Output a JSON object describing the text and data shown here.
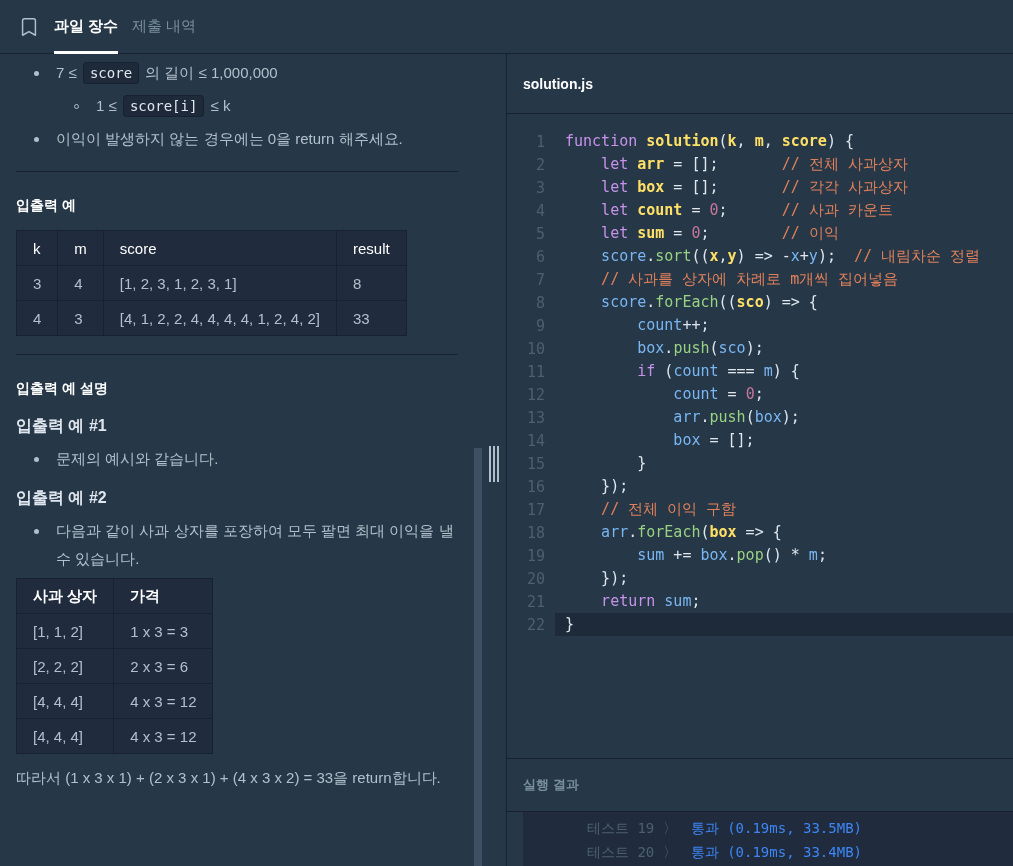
{
  "header": {
    "tabs": [
      {
        "label": "과일 장수",
        "selected": true
      },
      {
        "label": "제출 내역",
        "selected": false
      }
    ]
  },
  "problem": {
    "blocks": [
      {
        "kind": "bullets",
        "items": [
          {
            "parts": [
              {
                "kind": "text",
                "text": "7 ≤ "
              },
              {
                "kind": "code",
                "text": "score"
              },
              {
                "kind": "text",
                "text": " 의 길이 ≤ 1,000,000"
              }
            ],
            "children": [
              {
                "parts": [
                  {
                    "kind": "text",
                    "text": "1 ≤ "
                  },
                  {
                    "kind": "code",
                    "text": "score[i]"
                  },
                  {
                    "kind": "text",
                    "text": " ≤ k"
                  }
                ]
              }
            ]
          },
          {
            "parts": [
              {
                "kind": "text",
                "text": "이익이 발생하지 않는 경우에는 0을 return 해주세요."
              }
            ]
          }
        ]
      },
      {
        "kind": "divider"
      },
      {
        "kind": "heading",
        "text": "입출력 예"
      },
      {
        "kind": "table",
        "columns": [
          "k",
          "m",
          "score",
          "result"
        ],
        "rows": [
          [
            "3",
            "4",
            "[1, 2, 3, 1, 2, 3, 1]",
            "8"
          ],
          [
            "4",
            "3",
            "[4, 1, 2, 2, 4, 4, 4, 4, 1, 2, 4, 2]",
            "33"
          ]
        ]
      },
      {
        "kind": "divider"
      },
      {
        "kind": "heading",
        "text": "입출력 예 설명"
      },
      {
        "kind": "subheading",
        "text": "입출력 예 #1"
      },
      {
        "kind": "bullets",
        "items": [
          {
            "parts": [
              {
                "kind": "text",
                "text": "문제의 예시와 같습니다."
              }
            ]
          }
        ]
      },
      {
        "kind": "subheading",
        "text": "입출력 예 #2"
      },
      {
        "kind": "bullets",
        "items": [
          {
            "parts": [
              {
                "kind": "text",
                "text": "다음과 같이 사과 상자를 포장하여 모두 팔면 최대 이익을 낼 수 있습니다."
              }
            ]
          }
        ]
      },
      {
        "kind": "table",
        "columns": [
          "사과 상자",
          "가격"
        ],
        "rows": [
          [
            "[1, 1, 2]",
            "1 x 3 = 3"
          ],
          [
            "[2, 2, 2]",
            "2 x 3 = 6"
          ],
          [
            "[4, 4, 4]",
            "4 x 3 = 12"
          ],
          [
            "[4, 4, 4]",
            "4 x 3 = 12"
          ]
        ]
      },
      {
        "kind": "paragraph",
        "text": "따라서 (1 x 3 x 1) + (2 x 3 x 1) + (4 x 3 x 2) = 33을 return합니다."
      }
    ]
  },
  "editor": {
    "filename": "solution.js",
    "lines": [
      {
        "number": "1",
        "active": false,
        "tokens": [
          {
            "kind": "kw",
            "text": "function"
          },
          {
            "kind": "def",
            "text": " solution"
          },
          {
            "kind": "plain",
            "text": "("
          },
          {
            "kind": "def",
            "text": "k"
          },
          {
            "kind": "plain",
            "text": ", "
          },
          {
            "kind": "def",
            "text": "m"
          },
          {
            "kind": "plain",
            "text": ", "
          },
          {
            "kind": "def",
            "text": "score"
          },
          {
            "kind": "plain",
            "text": ") {"
          }
        ]
      },
      {
        "number": "2",
        "active": false,
        "tokens": [
          {
            "kind": "kw",
            "text": "    let"
          },
          {
            "kind": "def",
            "text": " arr"
          },
          {
            "kind": "plain",
            "text": " = [];       "
          },
          {
            "kind": "comment",
            "text": "// 전체 사과상자"
          }
        ]
      },
      {
        "number": "3",
        "active": false,
        "tokens": [
          {
            "kind": "kw",
            "text": "    let"
          },
          {
            "kind": "def",
            "text": " box"
          },
          {
            "kind": "plain",
            "text": " = [];       "
          },
          {
            "kind": "comment",
            "text": "// 각각 사과상자"
          }
        ]
      },
      {
        "number": "4",
        "active": false,
        "tokens": [
          {
            "kind": "kw",
            "text": "    let"
          },
          {
            "kind": "def",
            "text": " count"
          },
          {
            "kind": "plain",
            "text": " = "
          },
          {
            "kind": "num",
            "text": "0"
          },
          {
            "kind": "plain",
            "text": ";      "
          },
          {
            "kind": "comment",
            "text": "// 사과 카운트"
          }
        ]
      },
      {
        "number": "5",
        "active": false,
        "tokens": [
          {
            "kind": "kw",
            "text": "    let"
          },
          {
            "kind": "def",
            "text": " sum"
          },
          {
            "kind": "plain",
            "text": " = "
          },
          {
            "kind": "num",
            "text": "0"
          },
          {
            "kind": "plain",
            "text": ";        "
          },
          {
            "kind": "comment",
            "text": "// 이익"
          }
        ]
      },
      {
        "number": "6",
        "active": false,
        "tokens": [
          {
            "kind": "prop",
            "text": "    score"
          },
          {
            "kind": "plain",
            "text": "."
          },
          {
            "kind": "method",
            "text": "sort"
          },
          {
            "kind": "plain",
            "text": "(("
          },
          {
            "kind": "def",
            "text": "x"
          },
          {
            "kind": "plain",
            "text": ","
          },
          {
            "kind": "def",
            "text": "y"
          },
          {
            "kind": "plain",
            "text": ") => -"
          },
          {
            "kind": "prop",
            "text": "x"
          },
          {
            "kind": "plain",
            "text": "+"
          },
          {
            "kind": "prop",
            "text": "y"
          },
          {
            "kind": "plain",
            "text": ");  "
          },
          {
            "kind": "comment",
            "text": "// 내림차순 정렬"
          }
        ]
      },
      {
        "number": "7",
        "active": false,
        "tokens": [
          {
            "kind": "comment",
            "text": "    // 사과를 상자에 차례로 m개씩 집어넣음"
          }
        ]
      },
      {
        "number": "8",
        "active": false,
        "tokens": [
          {
            "kind": "prop",
            "text": "    score"
          },
          {
            "kind": "plain",
            "text": "."
          },
          {
            "kind": "method",
            "text": "forEach"
          },
          {
            "kind": "plain",
            "text": "(("
          },
          {
            "kind": "def",
            "text": "sco"
          },
          {
            "kind": "plain",
            "text": ") => {"
          }
        ]
      },
      {
        "number": "9",
        "active": false,
        "tokens": [
          {
            "kind": "prop",
            "text": "        count"
          },
          {
            "kind": "plain",
            "text": "++;"
          }
        ]
      },
      {
        "number": "10",
        "active": false,
        "tokens": [
          {
            "kind": "prop",
            "text": "        box"
          },
          {
            "kind": "plain",
            "text": "."
          },
          {
            "kind": "method",
            "text": "push"
          },
          {
            "kind": "plain",
            "text": "("
          },
          {
            "kind": "prop",
            "text": "sco"
          },
          {
            "kind": "plain",
            "text": ");"
          }
        ]
      },
      {
        "number": "11",
        "active": false,
        "tokens": [
          {
            "kind": "kw",
            "text": "        if"
          },
          {
            "kind": "plain",
            "text": " ("
          },
          {
            "kind": "prop",
            "text": "count"
          },
          {
            "kind": "plain",
            "text": " === "
          },
          {
            "kind": "prop",
            "text": "m"
          },
          {
            "kind": "plain",
            "text": ") {"
          }
        ]
      },
      {
        "number": "12",
        "active": false,
        "tokens": [
          {
            "kind": "prop",
            "text": "            count"
          },
          {
            "kind": "plain",
            "text": " = "
          },
          {
            "kind": "num",
            "text": "0"
          },
          {
            "kind": "plain",
            "text": ";"
          }
        ]
      },
      {
        "number": "13",
        "active": false,
        "tokens": [
          {
            "kind": "prop",
            "text": "            arr"
          },
          {
            "kind": "plain",
            "text": "."
          },
          {
            "kind": "method",
            "text": "push"
          },
          {
            "kind": "plain",
            "text": "("
          },
          {
            "kind": "prop",
            "text": "box"
          },
          {
            "kind": "plain",
            "text": ");"
          }
        ]
      },
      {
        "number": "14",
        "active": false,
        "tokens": [
          {
            "kind": "prop",
            "text": "            box"
          },
          {
            "kind": "plain",
            "text": " = [];"
          }
        ]
      },
      {
        "number": "15",
        "active": false,
        "tokens": [
          {
            "kind": "plain",
            "text": "        }"
          }
        ]
      },
      {
        "number": "16",
        "active": false,
        "tokens": [
          {
            "kind": "plain",
            "text": "    });"
          }
        ]
      },
      {
        "number": "17",
        "active": false,
        "tokens": [
          {
            "kind": "comment",
            "text": "    // 전체 이익 구함"
          }
        ]
      },
      {
        "number": "18",
        "active": false,
        "tokens": [
          {
            "kind": "prop",
            "text": "    arr"
          },
          {
            "kind": "plain",
            "text": "."
          },
          {
            "kind": "method",
            "text": "forEach"
          },
          {
            "kind": "plain",
            "text": "("
          },
          {
            "kind": "def",
            "text": "box"
          },
          {
            "kind": "plain",
            "text": " => {"
          }
        ]
      },
      {
        "number": "19",
        "active": false,
        "tokens": [
          {
            "kind": "prop",
            "text": "        sum"
          },
          {
            "kind": "plain",
            "text": " += "
          },
          {
            "kind": "prop",
            "text": "box"
          },
          {
            "kind": "plain",
            "text": "."
          },
          {
            "kind": "method",
            "text": "pop"
          },
          {
            "kind": "plain",
            "text": "() * "
          },
          {
            "kind": "prop",
            "text": "m"
          },
          {
            "kind": "plain",
            "text": ";"
          }
        ]
      },
      {
        "number": "20",
        "active": false,
        "tokens": [
          {
            "kind": "plain",
            "text": "    });"
          }
        ]
      },
      {
        "number": "21",
        "active": false,
        "tokens": [
          {
            "kind": "kw",
            "text": "    return"
          },
          {
            "kind": "prop",
            "text": " sum"
          },
          {
            "kind": "plain",
            "text": ";"
          }
        ]
      },
      {
        "number": "22",
        "active": true,
        "tokens": [
          {
            "kind": "plain",
            "text": "}"
          }
        ]
      }
    ]
  },
  "results": {
    "title": "실행 결과",
    "items": [
      {
        "label": "테스트 19 〉",
        "result": "통과 (0.19ms, 33.5MB)",
        "passed": true
      },
      {
        "label": "테스트 20 〉",
        "result": "통과 (0.19ms, 33.4MB)",
        "passed": true
      }
    ]
  }
}
